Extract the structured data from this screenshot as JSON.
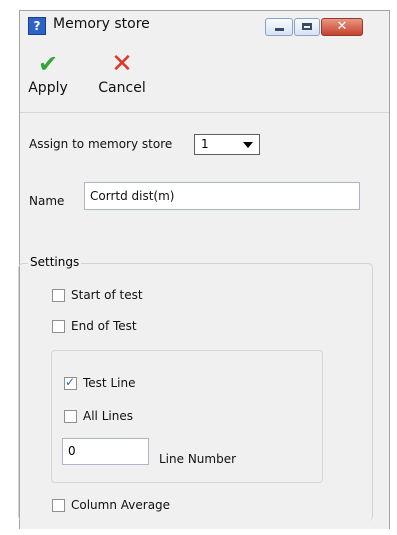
{
  "window": {
    "title": "Memory store",
    "app_icon_glyph": "?"
  },
  "title_buttons": {
    "minimize": "",
    "maximize": "",
    "close": "✕"
  },
  "toolbar": {
    "apply": {
      "label": "Apply",
      "icon": "checkmark-icon",
      "glyph": "✔",
      "color": "#3aa33b"
    },
    "cancel": {
      "label": "Cancel",
      "icon": "x-icon",
      "glyph": "✕",
      "color": "#e0362c"
    }
  },
  "assign": {
    "label": "Assign to memory store",
    "value": "1"
  },
  "name": {
    "label": "Name",
    "value": "Corrtd dist(m)"
  },
  "settings": {
    "title": "Settings",
    "start_of_test": {
      "label": "Start of test",
      "checked": false
    },
    "end_of_test": {
      "label": "End of Test",
      "checked": false
    },
    "test_line": {
      "label": "Test Line",
      "checked": true
    },
    "all_lines": {
      "label": "All Lines",
      "checked": false
    },
    "line_number": {
      "label": "Line Number",
      "value": "0"
    },
    "column_average": {
      "label": "Column Average",
      "checked": false
    }
  },
  "colors": {
    "accent": "#2b63c6",
    "background": "#f0f0f0"
  }
}
